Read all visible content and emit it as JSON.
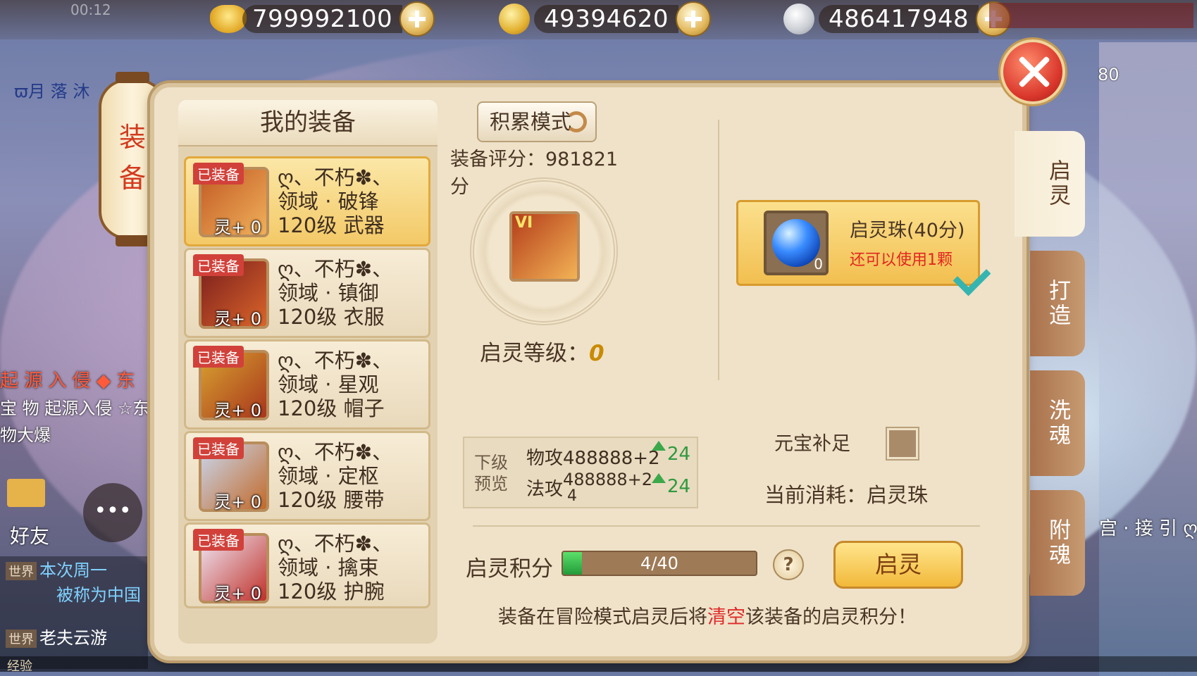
{
  "currency": [
    {
      "icon": "gold-ingot-icon",
      "value": "799992100"
    },
    {
      "icon": "gold-coin-icon",
      "value": "49394620"
    },
    {
      "icon": "silver-coin-icon",
      "value": "486417948"
    }
  ],
  "status": {
    "time": "00:12"
  },
  "lantern_title": "装\n备",
  "left_panel": {
    "title": "我的装备",
    "items": [
      {
        "badge": "已装备",
        "name1": "ღ、不朽✽、",
        "name2": "领域 · 破锋",
        "level": "120级 武器",
        "ling": "灵+ 0",
        "selected": true
      },
      {
        "badge": "已装备",
        "name1": "ღ、不朽✽、",
        "name2": "领域 · 镇御",
        "level": "120级 衣服",
        "ling": "灵+ 0",
        "selected": false
      },
      {
        "badge": "已装备",
        "name1": "ღ、不朽✽、",
        "name2": "领域 · 星观",
        "level": "120级 帽子",
        "ling": "灵+ 0",
        "selected": false
      },
      {
        "badge": "已装备",
        "name1": "ღ、不朽✽、",
        "name2": "领域 · 定枢",
        "level": "120级 腰带",
        "ling": "灵+ 0",
        "selected": false
      },
      {
        "badge": "已装备",
        "name1": "ღ、不朽✽、",
        "name2": "领域 · 擒束",
        "level": "120级 护腕",
        "ling": "灵+ 0",
        "selected": false
      }
    ]
  },
  "center": {
    "mode_button": "积累模式",
    "score_label": "装备评分：981821分",
    "grade": "VI",
    "qiling_level_label": "启灵等级：",
    "qiling_level_value": "0",
    "preview": {
      "header": "下级预览",
      "row1_label": "物攻",
      "row1_value": "488888+2",
      "row1_up": "24",
      "row2_label": "法攻",
      "row2_value": "488888+2",
      "row2_value_wrap": "4",
      "row2_up": "24"
    },
    "points_label": "启灵积分",
    "points": {
      "current": 4,
      "max": 40,
      "text": "4/40"
    },
    "help": "?",
    "qiling_button": "启灵",
    "warning_pre": "装备在冒险模式启灵后将",
    "warning_red": "清空",
    "warning_post": "该装备的启灵积分！"
  },
  "right": {
    "item_name": "启灵珠(40分)",
    "item_use": "还可以使用1颗",
    "item_count": "0",
    "yuanbao_label": "元宝补足",
    "cost_label": "当前消耗：",
    "cost_value": "启灵珠"
  },
  "tabs": [
    "启灵",
    "打造",
    "洗魂",
    "附魂"
  ],
  "side": {
    "friend_label": "好友",
    "ticker1": "起 源 入 侵 ◆ 东",
    "ticker2": "宝 物 起源入侵 ☆东",
    "ticker3": "物大爆",
    "chat_tag1": "世界",
    "chat_line1": "本次周一",
    "chat_line2": "被称为中国",
    "chat_tag2": "世界",
    "chat_line3": "老夫云游",
    "bottom_label": "经验",
    "moon_name": "ϖ月 落 沐",
    "player_level": "80",
    "right_chat": "宫 · 接 引 ღ"
  },
  "colors": {
    "accent": "#f2bf50",
    "warning": "#e02a2a",
    "progress": "#229b39"
  }
}
